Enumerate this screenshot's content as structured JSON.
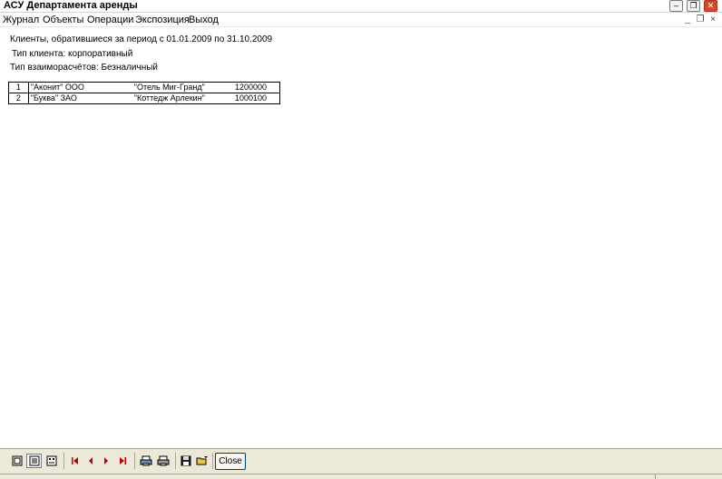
{
  "window": {
    "title": "АСУ Департамента аренды",
    "minimize": "–",
    "restore": "❐",
    "close": "✕"
  },
  "menu": {
    "items": [
      "Журнал",
      "Объекты",
      "Операции",
      "Экспозиция",
      "Выход"
    ],
    "mdi_minimize": "_",
    "mdi_restore": "❐",
    "mdi_close": "×"
  },
  "report": {
    "header_line": "Клиенты, обратившиеся за период  с 01.01.2009 по 31.10.2009",
    "client_type_line": "Тип клиента: корпоративный",
    "payment_type_line": "Тип взаиморасчётов: Безналичный",
    "rows": [
      {
        "num": "1",
        "client": "\"Аконит\" ООО",
        "object": "\"Отель Миг-Гранд\"",
        "amount": "1200000"
      },
      {
        "num": "2",
        "client": "\"Буква\" ЗАО",
        "object": "\"Коттедж Арлекин\"",
        "amount": "1000100"
      }
    ]
  },
  "toolbar": {
    "close_label": "Close"
  },
  "icons": {
    "one_page": "single-page-view-icon",
    "page_width": "page-width-view-icon",
    "multi_page": "multi-page-view-icon",
    "first": "first-page-icon",
    "prev": "previous-page-icon",
    "next": "next-page-icon",
    "last": "last-page-icon",
    "print_setup": "print-setup-icon",
    "print": "print-icon",
    "save": "save-icon",
    "open": "open-icon"
  },
  "colors": {
    "toolbar_bg": "#ece9d8",
    "close_button_bg": "#d9472b",
    "nav_arrow": "#c00000"
  }
}
